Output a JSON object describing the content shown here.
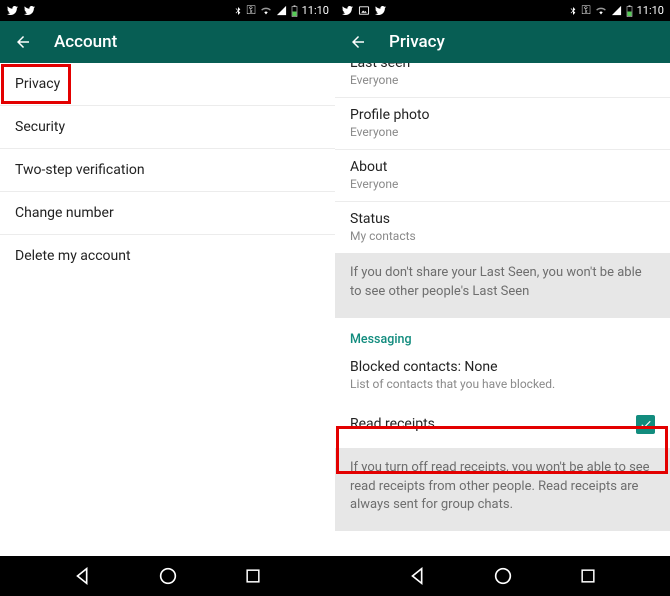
{
  "status": {
    "time": "11:10",
    "icons_left_a": [
      "twitter-icon",
      "twitter-icon"
    ],
    "icons_left_b": [
      "twitter-icon",
      "image-icon",
      "twitter-icon"
    ]
  },
  "left": {
    "title": "Account",
    "items": [
      {
        "label": "Privacy"
      },
      {
        "label": "Security"
      },
      {
        "label": "Two-step verification"
      },
      {
        "label": "Change number"
      },
      {
        "label": "Delete my account"
      }
    ]
  },
  "right": {
    "title": "Privacy",
    "prefs": {
      "lastseen": {
        "title": "Last seen",
        "sub": "Everyone"
      },
      "photo": {
        "title": "Profile photo",
        "sub": "Everyone"
      },
      "about": {
        "title": "About",
        "sub": "Everyone"
      },
      "status": {
        "title": "Status",
        "sub": "My contacts"
      }
    },
    "info1": "If you don't share your Last Seen, you won't be able to see other people's Last Seen",
    "messaging_header": "Messaging",
    "blocked": {
      "title": "Blocked contacts: None",
      "sub": "List of contacts that you have blocked."
    },
    "read_receipts": {
      "title": "Read receipts",
      "checked": true
    },
    "info2": "If you turn off read receipts, you won't be able to see read receipts from other people. Read receipts are always sent for group chats."
  }
}
